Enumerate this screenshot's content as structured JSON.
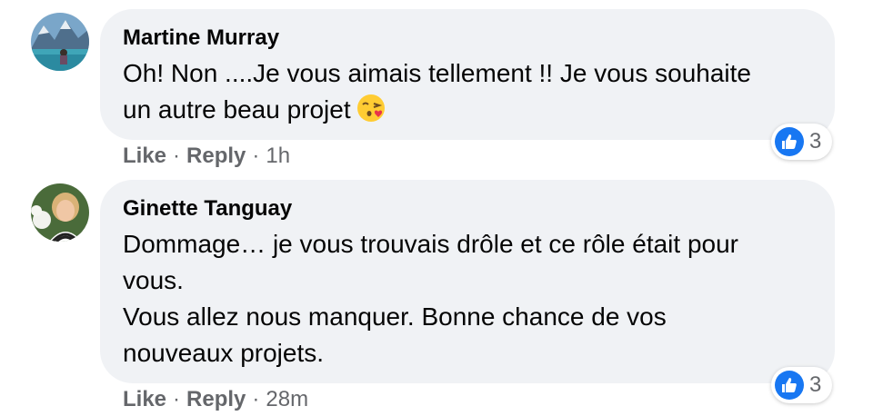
{
  "comments": [
    {
      "author": "Martine Murray",
      "text_line1": "Oh! Non ....Je vous aimais tellement !! Je vous souhaite",
      "text_line2": "un autre beau projet",
      "emoji": "face-blowing-a-kiss",
      "reaction_icon": "like-icon",
      "reaction_count": "3",
      "like_label": "Like",
      "separator": "·",
      "reply_label": "Reply",
      "timestamp": "1h"
    },
    {
      "author": "Ginette Tanguay",
      "text_line1": "Dommage… je vous trouvais drôle et ce rôle était pour",
      "text_line2": "vous.",
      "text_line3": "Vous allez nous manquer. Bonne chance de vos",
      "text_line4": "nouveaux projets.",
      "reaction_icon": "like-icon",
      "reaction_count": "3",
      "like_label": "Like",
      "separator": "·",
      "reply_label": "Reply",
      "timestamp": "28m"
    }
  ],
  "colors": {
    "bubble_bg": "#f0f2f5",
    "text": "#050505",
    "secondary_text": "#65676b",
    "like_blue": "#1877f2"
  }
}
